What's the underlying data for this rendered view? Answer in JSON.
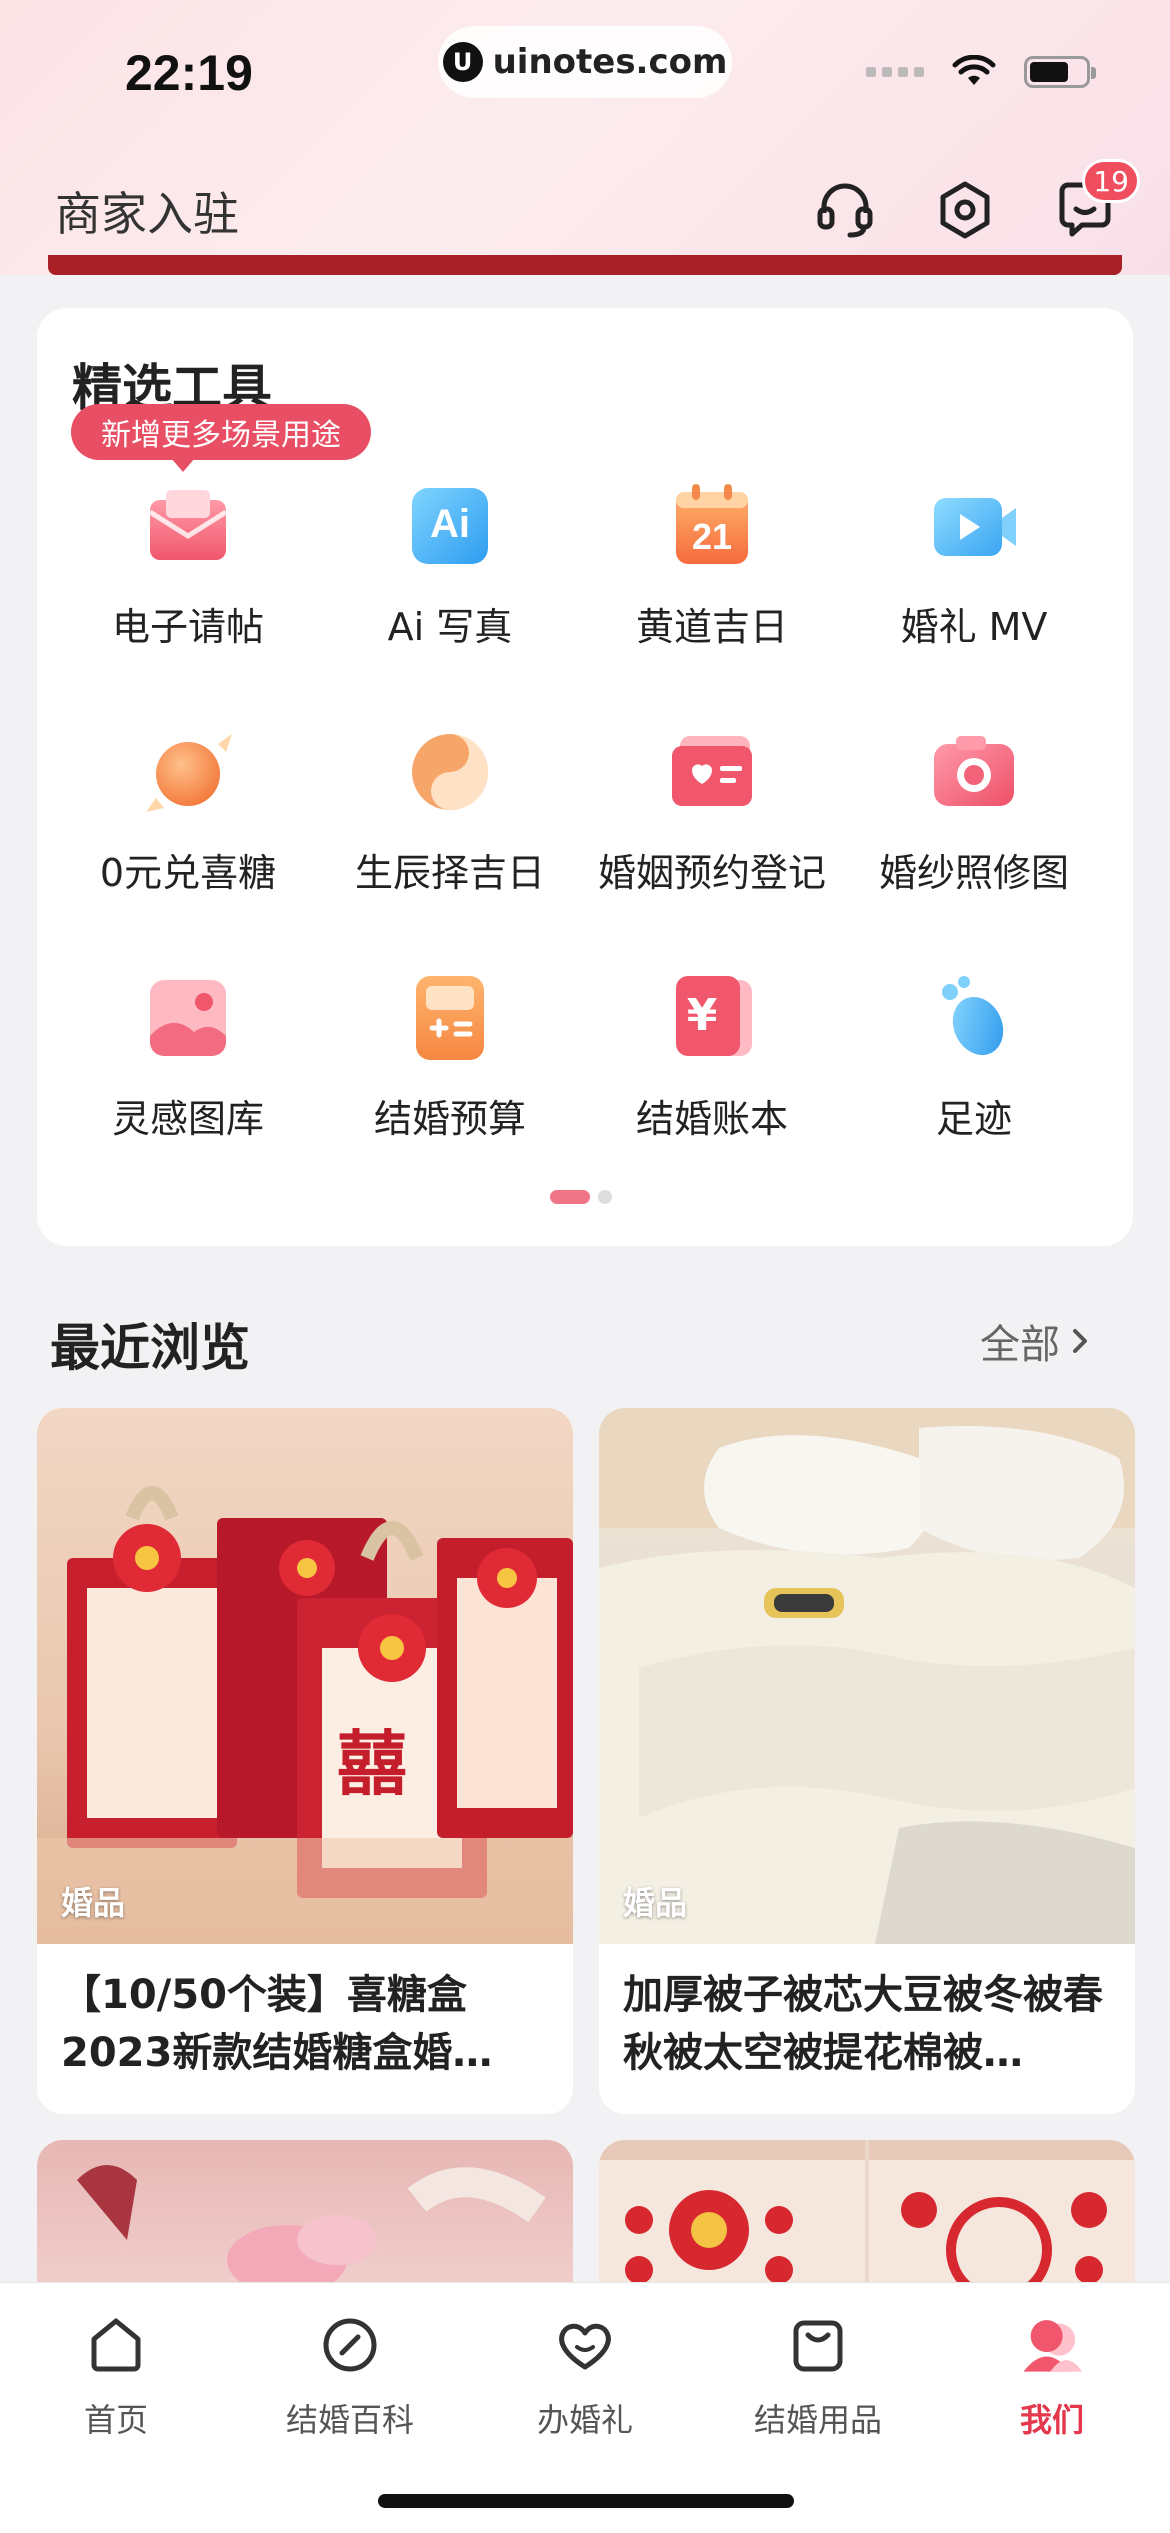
{
  "status_bar": {
    "time": "22:19",
    "url": "uinotes.com",
    "url_logo": "U"
  },
  "header": {
    "merchant_label": "商家入驻",
    "message_badge": "19"
  },
  "tools": {
    "title": "精选工具",
    "tip": "新增更多场景用途",
    "items": [
      {
        "label": "电子请帖",
        "icon": "envelope-icon"
      },
      {
        "label": "Ai 写真",
        "icon": "ai-icon",
        "icon_text": "Ai"
      },
      {
        "label": "黄道吉日",
        "icon": "calendar-icon",
        "icon_text": "21"
      },
      {
        "label": "婚礼 MV",
        "icon": "video-icon"
      },
      {
        "label": "0元兑喜糖",
        "icon": "candy-icon"
      },
      {
        "label": "生辰择吉日",
        "icon": "yin-yang-icon"
      },
      {
        "label": "婚姻预约登记",
        "icon": "certificate-icon"
      },
      {
        "label": "婚纱照修图",
        "icon": "camera-icon"
      },
      {
        "label": "灵感图库",
        "icon": "gallery-icon"
      },
      {
        "label": "结婚预算",
        "icon": "calculator-icon"
      },
      {
        "label": "结婚账本",
        "icon": "ledger-icon",
        "icon_text": "¥"
      },
      {
        "label": "足迹",
        "icon": "footprint-icon"
      }
    ],
    "page_count": 2,
    "current_page": 1
  },
  "recent": {
    "title": "最近浏览",
    "all_label": "全部",
    "products": [
      {
        "tag": "婚品",
        "name": "【10/50个装】喜糖盒2023新款结婚糖盒婚…",
        "img_text": "囍"
      },
      {
        "tag": "婚品",
        "name": "加厚被子被芯大豆被冬被春秋被太空被提花棉被…"
      }
    ]
  },
  "bottom_nav": {
    "items": [
      {
        "label": "首页",
        "icon": "home-icon"
      },
      {
        "label": "结婚百科",
        "icon": "encyclopedia-icon"
      },
      {
        "label": "办婚礼",
        "icon": "heart-icon"
      },
      {
        "label": "结婚用品",
        "icon": "bag-icon"
      },
      {
        "label": "我们",
        "icon": "profile-icon"
      }
    ],
    "active_index": 4
  },
  "colors": {
    "accent": "#e4384d",
    "tip_bg": "#e94f64"
  }
}
